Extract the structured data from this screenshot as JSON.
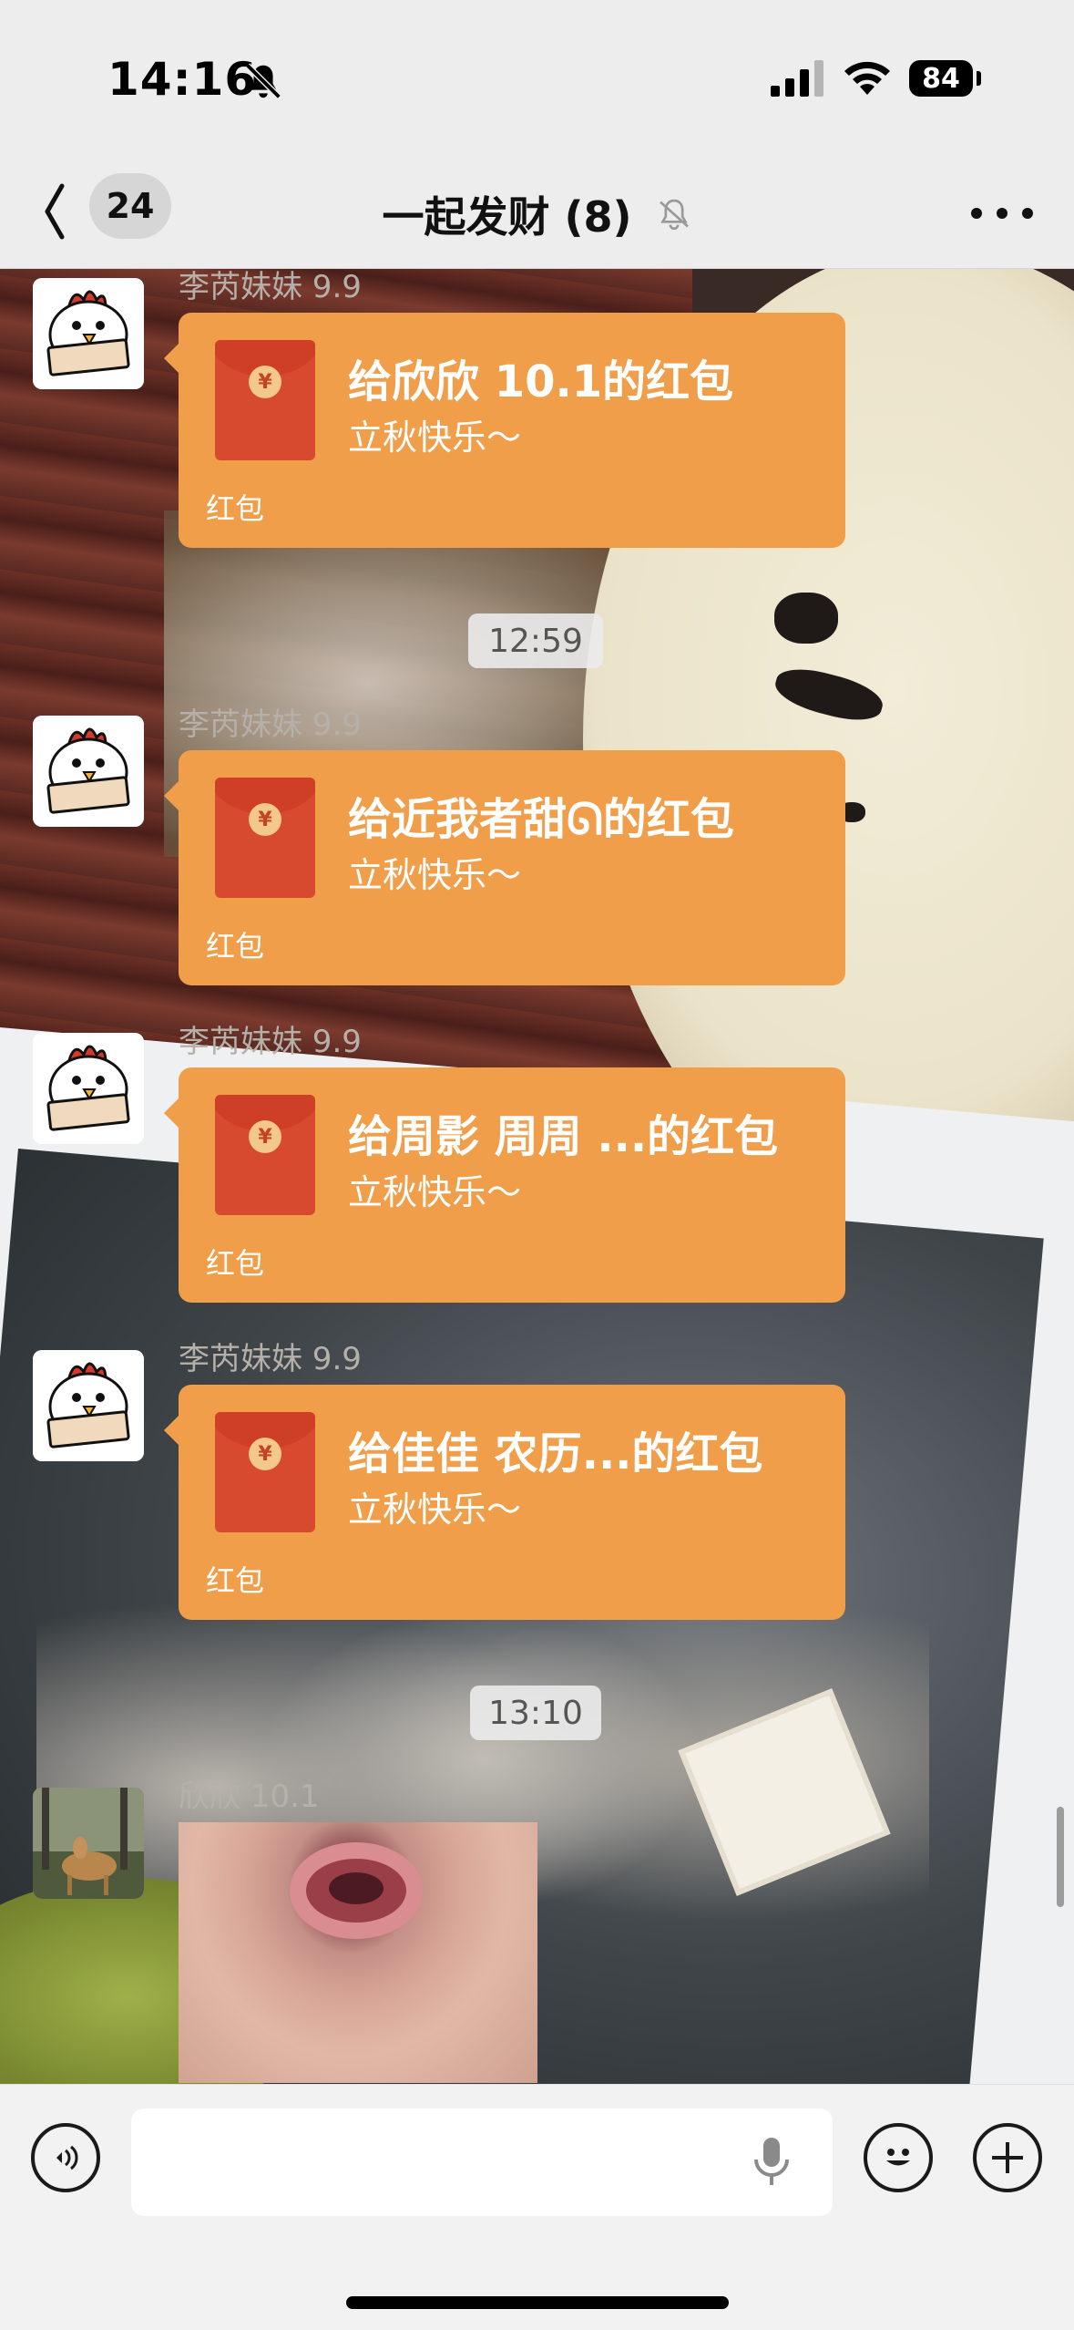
{
  "status_bar": {
    "time": "14:16",
    "battery": "84",
    "icons": [
      "bell-slash-icon",
      "signal-icon",
      "wifi-icon",
      "battery-icon"
    ]
  },
  "nav": {
    "unread_count": "24",
    "title": "一起发财 (8)",
    "icons": [
      "back-chevron-icon",
      "bell-slash-icon",
      "more-dots-icon"
    ]
  },
  "colors": {
    "red_packet": "#f09e49",
    "packet_body": "#d84a30",
    "nav_bg": "#ededed"
  },
  "messages": [
    {
      "type": "red_packet",
      "sender": "李芮妹妹 9.9",
      "title": "给欣欣 10.1的红包",
      "subtitle": "立秋快乐～",
      "footer": "红包"
    },
    {
      "type": "timestamp",
      "text": "12:59"
    },
    {
      "type": "red_packet",
      "sender": "李芮妹妹 9.9",
      "title": "给近我者甜ᘏ的红包",
      "subtitle": "立秋快乐～",
      "footer": "红包"
    },
    {
      "type": "red_packet",
      "sender": "李芮妹妹 9.9",
      "title": "给周影 周周 ...的红包",
      "subtitle": "立秋快乐～",
      "footer": "红包"
    },
    {
      "type": "red_packet",
      "sender": "李芮妹妹 9.9",
      "title": "给佳佳 农历...的红包",
      "subtitle": "立秋快乐～",
      "footer": "红包"
    },
    {
      "type": "timestamp",
      "text": "13:10"
    },
    {
      "type": "image",
      "sender": "欣欣 10.1"
    }
  ],
  "input_bar": {
    "value": "",
    "placeholder": "",
    "icons": [
      "voice-icon",
      "microphone-icon",
      "emoji-icon",
      "add-icon"
    ]
  }
}
